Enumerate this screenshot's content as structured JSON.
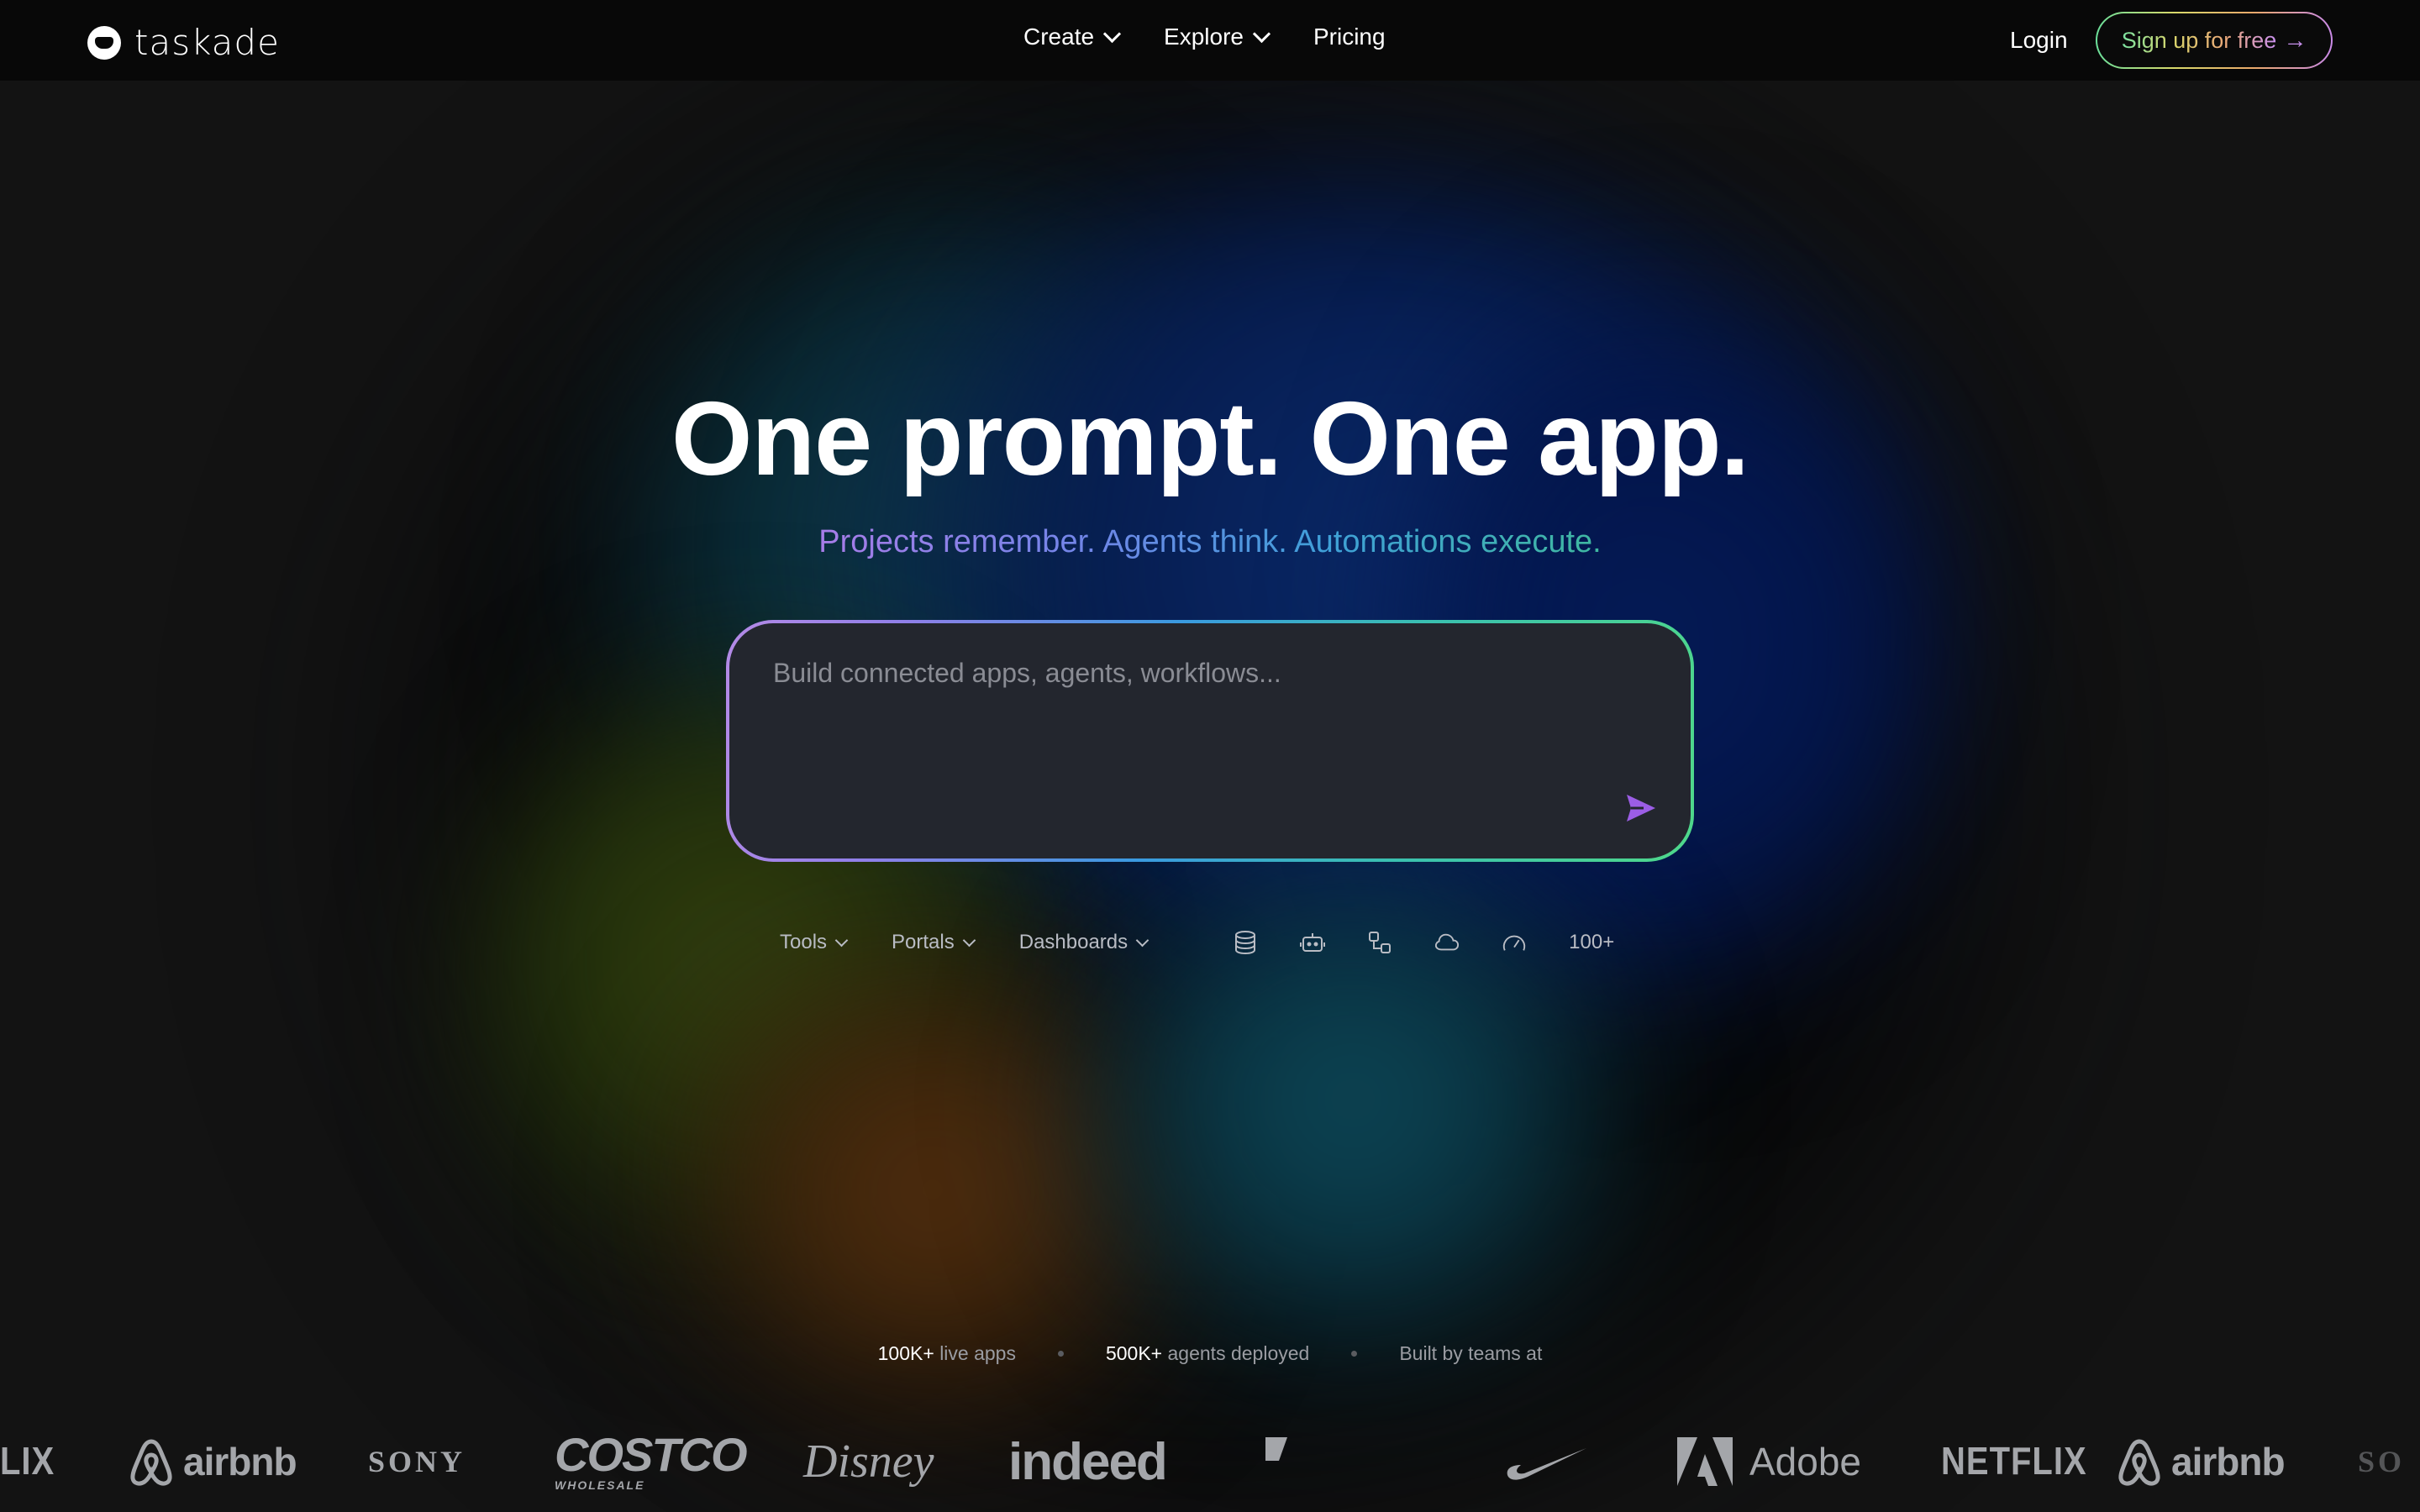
{
  "nav": {
    "logo_text": "taskade",
    "menu": [
      {
        "label": "Create",
        "has_dropdown": true
      },
      {
        "label": "Explore",
        "has_dropdown": true
      },
      {
        "label": "Pricing",
        "has_dropdown": false
      }
    ],
    "login_label": "Login",
    "signup_label": "Sign up for free",
    "signup_arrow": "→"
  },
  "hero": {
    "title": "One prompt. One app.",
    "subtitle": "Projects remember. Agents think. Automations execute."
  },
  "prompt": {
    "placeholder": "Build connected apps, agents, workflows...",
    "value": "",
    "send_icon": "send-icon"
  },
  "toolbar": {
    "dropdowns": [
      "Tools",
      "Portals",
      "Dashboards"
    ],
    "icons": [
      "database-icon",
      "robot-icon",
      "workflow-icon",
      "cloud-icon",
      "gauge-icon"
    ],
    "more_label": "100+"
  },
  "stats": {
    "live_apps_value": "100K+",
    "live_apps_label": "live apps",
    "agents_value": "500K+",
    "agents_label": "agents deployed",
    "teams_label": "Built by teams at"
  },
  "logos": {
    "items": [
      {
        "name": "netflix-partial",
        "text": "LIX"
      },
      {
        "name": "airbnb",
        "text": "airbnb"
      },
      {
        "name": "sony",
        "text": "SONY"
      },
      {
        "name": "costco",
        "text": "COSTCO",
        "sub": "WHOLESALE"
      },
      {
        "name": "disney",
        "text": "Disney"
      },
      {
        "name": "indeed",
        "text": "indeed"
      },
      {
        "name": "nike",
        "text": ""
      },
      {
        "name": "adobe",
        "text": "Adobe"
      },
      {
        "name": "netflix",
        "text": "NETFLIX"
      },
      {
        "name": "airbnb",
        "text": "airbnb"
      },
      {
        "name": "sony-partial",
        "text": "SO"
      }
    ]
  },
  "colors": {
    "background": "#131313",
    "nav_background": "#080808",
    "prompt_background": "#23262e",
    "send_accent": "#9b5de5",
    "muted_text": "#9a9ca2"
  }
}
